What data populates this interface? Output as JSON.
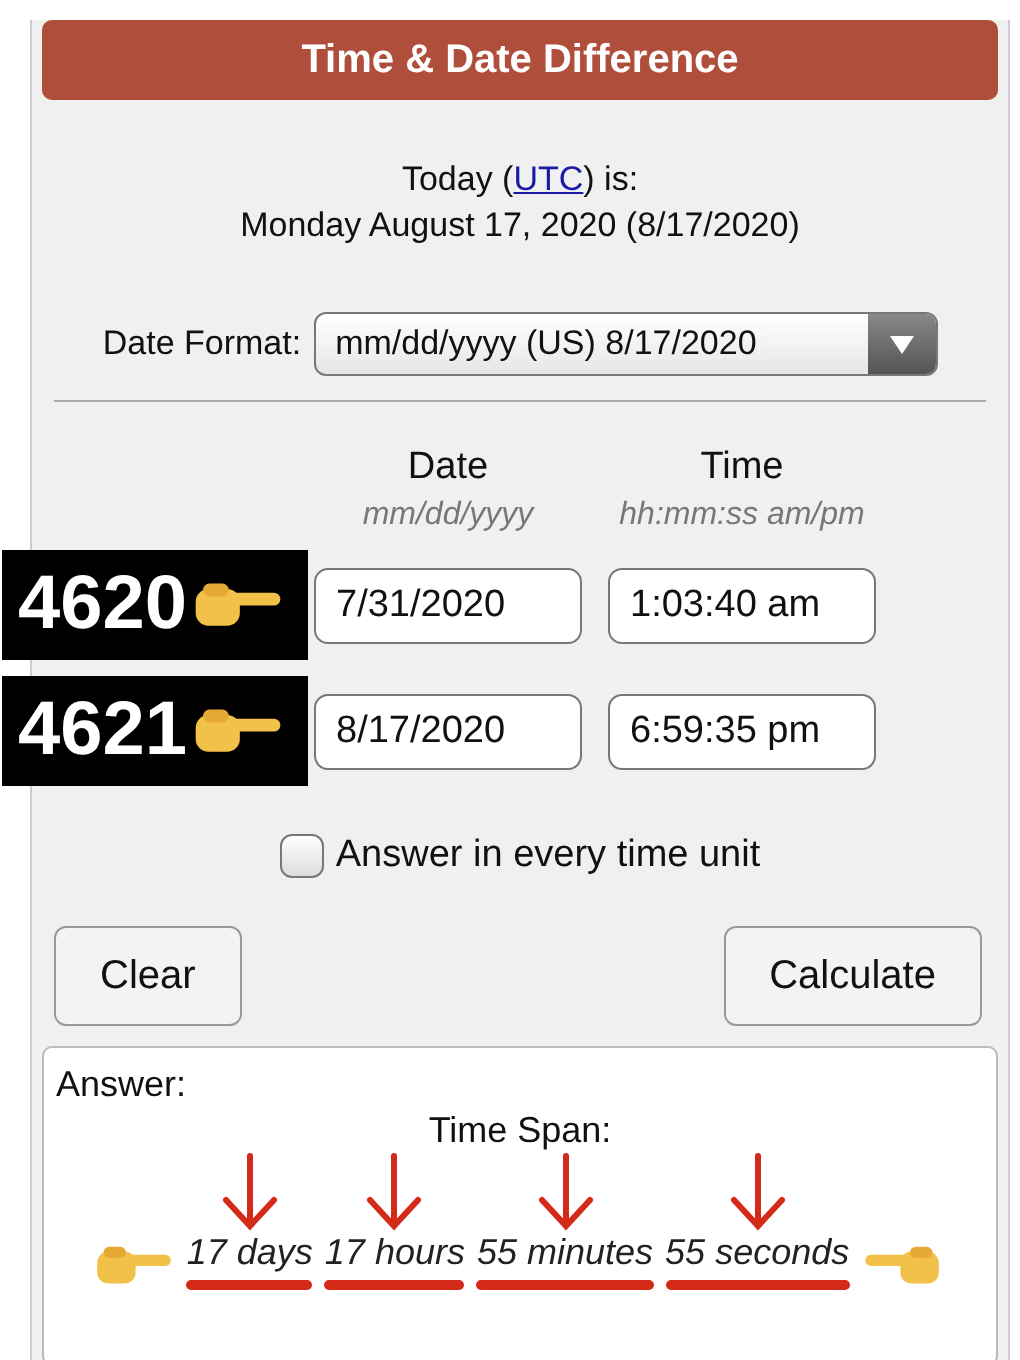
{
  "header": {
    "title": "Time & Date Difference"
  },
  "today": {
    "prefix": "Today (",
    "link": "UTC",
    "suffix": ") is:",
    "date": "Monday August 17, 2020 (8/17/2020)"
  },
  "date_format": {
    "label": "Date Format:",
    "value": "mm/dd/yyyy (US) 8/17/2020"
  },
  "columns": [
    {
      "heading": "Date",
      "hint": "mm/dd/yyyy"
    },
    {
      "heading": "Time",
      "hint": "hh:mm:ss am/pm"
    }
  ],
  "rows": [
    {
      "annotation": "4620",
      "date": "7/31/2020",
      "time": "1:03:40 am"
    },
    {
      "annotation": "4621",
      "date": "8/17/2020",
      "time": "6:59:35 pm"
    }
  ],
  "checkbox": {
    "label": "Answer in every time unit",
    "checked": false
  },
  "buttons": [
    "Clear",
    "Calculate"
  ],
  "answer": {
    "label": "Answer:",
    "span_label": "Time Span:",
    "parts": [
      "17 days",
      "17 hours",
      "55 minutes",
      "55 seconds"
    ]
  }
}
